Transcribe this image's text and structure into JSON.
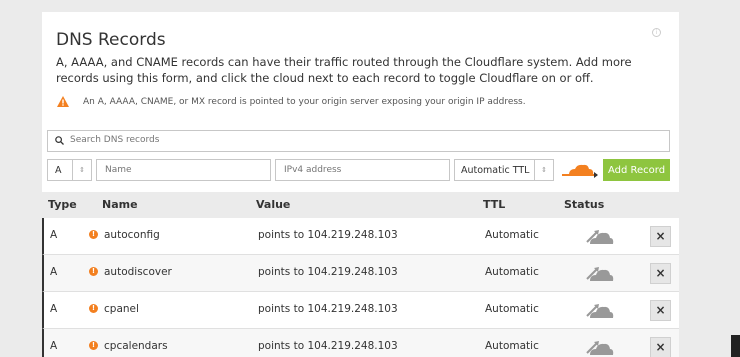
{
  "card": {
    "title": "DNS Records",
    "description": "A, AAAA, and CNAME records can have their traffic routed through the Cloudflare system. Add more records using this form, and click the cloud next to each record to toggle Cloudflare on or off.",
    "warning": "An A, AAAA, CNAME, or MX record is pointed to your origin server exposing your origin IP address."
  },
  "search": {
    "placeholder": "Search DNS records"
  },
  "form": {
    "type_value": "A",
    "name_placeholder": "Name",
    "ip_placeholder": "IPv4 address",
    "ttl_value": "Automatic TTL",
    "add_label": "Add Record"
  },
  "table": {
    "headers": {
      "type": "Type",
      "name": "Name",
      "value": "Value",
      "ttl": "TTL",
      "status": "Status"
    },
    "rows": [
      {
        "type": "A",
        "name": "autoconfig",
        "value": "points to 104.219.248.103",
        "ttl": "Automatic"
      },
      {
        "type": "A",
        "name": "autodiscover",
        "value": "points to 104.219.248.103",
        "ttl": "Automatic"
      },
      {
        "type": "A",
        "name": "cpanel",
        "value": "points to 104.219.248.103",
        "ttl": "Automatic"
      },
      {
        "type": "A",
        "name": "cpcalendars",
        "value": "points to 104.219.248.103",
        "ttl": "Automatic"
      }
    ]
  },
  "colors": {
    "accent": "#8ec53f",
    "cloud_orange": "#f38020",
    "status_gray": "#999999"
  },
  "icons": {
    "warning": "warning-icon",
    "search": "search-icon",
    "cloud": "cloud-icon",
    "delete": "close-icon"
  }
}
